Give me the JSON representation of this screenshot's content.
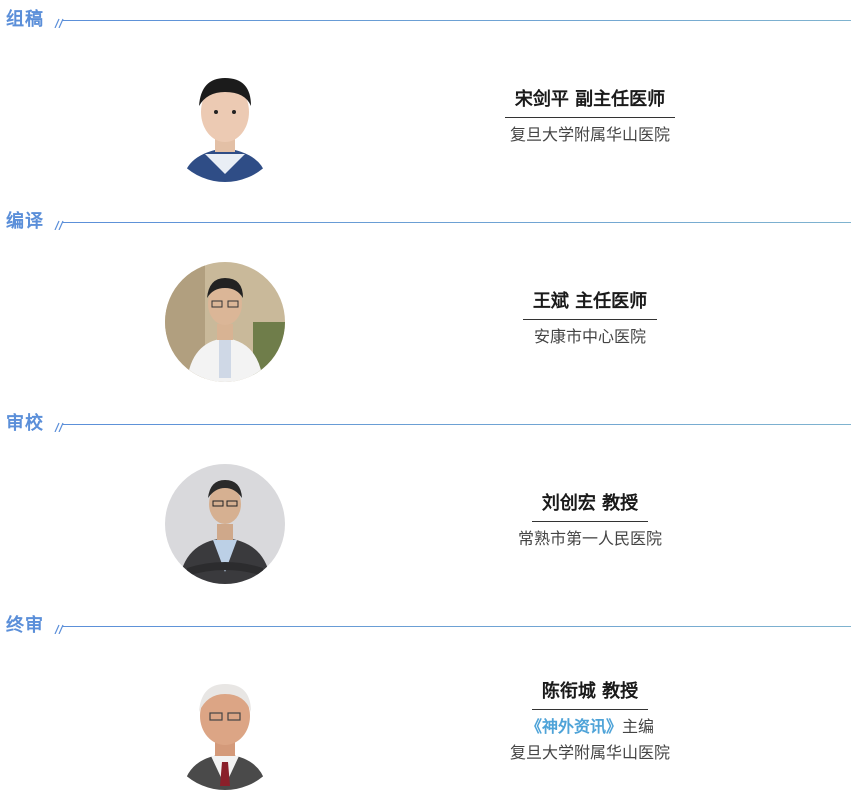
{
  "sections": [
    {
      "title": "组稿",
      "name": "宋剑平 副主任医师",
      "lines": [
        "复旦大学附属华山医院"
      ]
    },
    {
      "title": "编译",
      "name": "王斌 主任医师",
      "lines": [
        "安康市中心医院"
      ]
    },
    {
      "title": "审校",
      "name": "刘创宏 教授",
      "lines": [
        "常熟市第一人民医院"
      ]
    },
    {
      "title": "终审",
      "name": "陈衔城 教授",
      "journal": "《神外资讯》",
      "journal_suffix": "主编",
      "lines": [
        "复旦大学附属华山医院"
      ]
    }
  ],
  "colors": {
    "accent": "#5b8fd9",
    "journal": "#4ea3d8"
  },
  "icons": [
    "portrait-photo"
  ]
}
